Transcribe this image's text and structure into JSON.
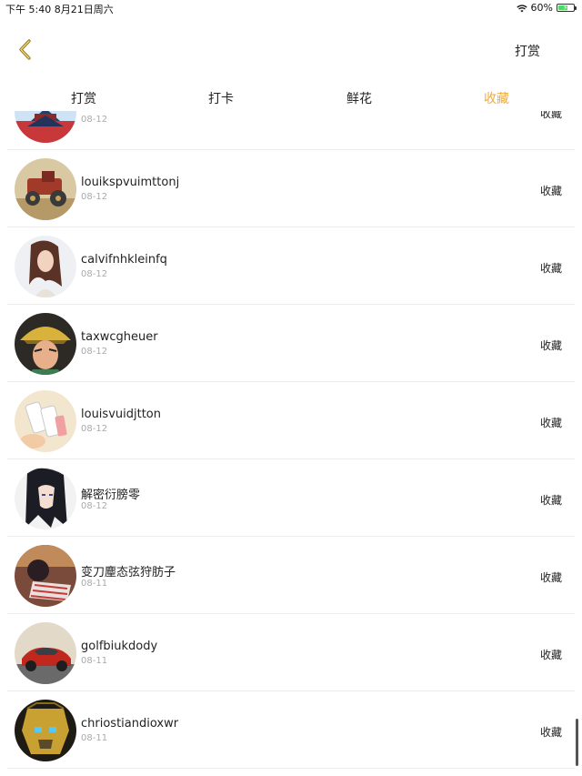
{
  "status_bar": {
    "time_date": "下午 5:40   8月21日周六",
    "battery_percent": "60%",
    "battery_level": 0.6
  },
  "nav": {
    "action_label": "打赏"
  },
  "tabs": [
    {
      "label": "打赏",
      "active": false
    },
    {
      "label": "打卡",
      "active": false
    },
    {
      "label": "鲜花",
      "active": false
    },
    {
      "label": "收藏",
      "active": true
    }
  ],
  "colors": {
    "accent": "#f0a93b"
  },
  "items": [
    {
      "name": "",
      "date": "08-12",
      "action": "收藏",
      "avatar": "temple"
    },
    {
      "name": "louikspvuimttonj",
      "date": "08-12",
      "action": "收藏",
      "avatar": "car-toy"
    },
    {
      "name": "calvifnhkleinfq",
      "date": "08-12",
      "action": "收藏",
      "avatar": "girl"
    },
    {
      "name": "taxwcgheuer",
      "date": "08-12",
      "action": "收藏",
      "avatar": "warrior"
    },
    {
      "name": "louisvuidjtton",
      "date": "08-12",
      "action": "收藏",
      "avatar": "phones"
    },
    {
      "name": "解密衍膀零",
      "date": "08-12",
      "action": "收藏",
      "avatar": "anime"
    },
    {
      "name": "变刀麈态弦狩肪子",
      "date": "08-11",
      "action": "收藏",
      "avatar": "striped"
    },
    {
      "name": "golfbiukdody",
      "date": "08-11",
      "action": "收藏",
      "avatar": "red-car"
    },
    {
      "name": "chriostiandioxwr",
      "date": "08-11",
      "action": "收藏",
      "avatar": "robot"
    }
  ]
}
